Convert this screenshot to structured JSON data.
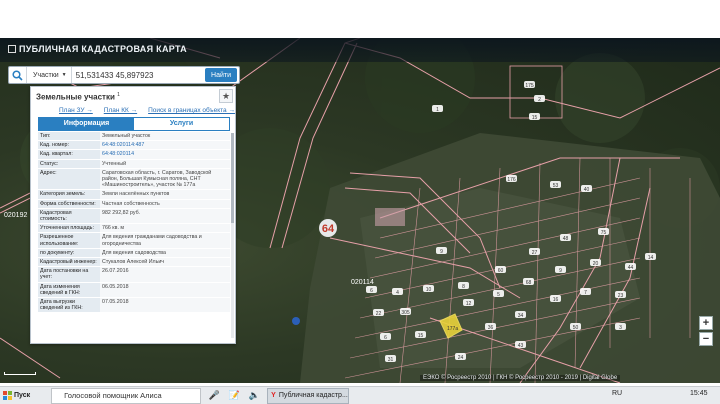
{
  "app": {
    "title": "Публичная кадастровая карта"
  },
  "search": {
    "type_label": "Участки",
    "value": "51,531433 45,897923",
    "button": "Найти"
  },
  "panel": {
    "title": "Земельные участки",
    "count": "1",
    "links": [
      "План ЗУ →",
      "План КК →",
      "Поиск в границах объекта →"
    ],
    "tabs": [
      "Информация",
      "Услуги"
    ],
    "rows": [
      {
        "k": "Тип:",
        "v": "Земельный участок"
      },
      {
        "k": "Кад. номер:",
        "v": "64:48:020114:487"
      },
      {
        "k": "Кад. квартал:",
        "v": "64:48:020114"
      },
      {
        "k": "Статус:",
        "v": "Учтенный"
      },
      {
        "k": "Адрес:",
        "v": "Саратовская область, г. Саратов, Заводской район, Большая Кумысная поляна, СНТ «Машиностроитель», участок № 177а"
      },
      {
        "k": "Категория земель:",
        "v": "Земли населённых пунктов"
      },
      {
        "k": "Форма собственности:",
        "v": "Частная собственность"
      },
      {
        "k": "Кадастровая стоимость:",
        "v": "982 292,82 руб."
      },
      {
        "k": "Уточненная площадь:",
        "v": "766 кв. м"
      },
      {
        "k": "Разрешенное использование:",
        "v": "Для ведения гражданами садоводства и огородничества"
      },
      {
        "k": "по документу:",
        "v": "Для ведения садоводства"
      },
      {
        "k": "Кадастровый инженер:",
        "v": "Стукалов Алексей Ильич"
      },
      {
        "k": "Дата постановки на учет:",
        "v": "26.07.2016"
      },
      {
        "k": "Дата изменения сведений в ГКН:",
        "v": "06.05.2018"
      },
      {
        "k": "Дата выгрузки сведений из ГКН:",
        "v": "07.05.2018"
      }
    ]
  },
  "map": {
    "labels": {
      "road": "64",
      "block": "020114",
      "left_block": "020192",
      "parcel_177a": "177а"
    },
    "parcel_numbers": [
      "1",
      "175",
      "2",
      "15",
      "176",
      "53",
      "40",
      "9",
      "6",
      "4",
      "10",
      "8",
      "60",
      "27",
      "48",
      "75",
      "22",
      "305",
      "12",
      "5",
      "68",
      "9",
      "20",
      "44",
      "6",
      "15",
      "36",
      "34",
      "16",
      "7",
      "23",
      "14",
      "31",
      "24",
      "43",
      "50",
      "3"
    ],
    "attribution": "ЕЭКО © Росреестр 2010 | ГКН © Росреестр 2010 - 2019 | Digital Globe",
    "zoom_in": "+",
    "zoom_out": "−"
  },
  "taskbar": {
    "start": "Пуск",
    "assistant": "Голосовой помощник Алиса",
    "browser_tab": "Публичная кадастр...",
    "lang": "RU",
    "time": "15:45"
  }
}
